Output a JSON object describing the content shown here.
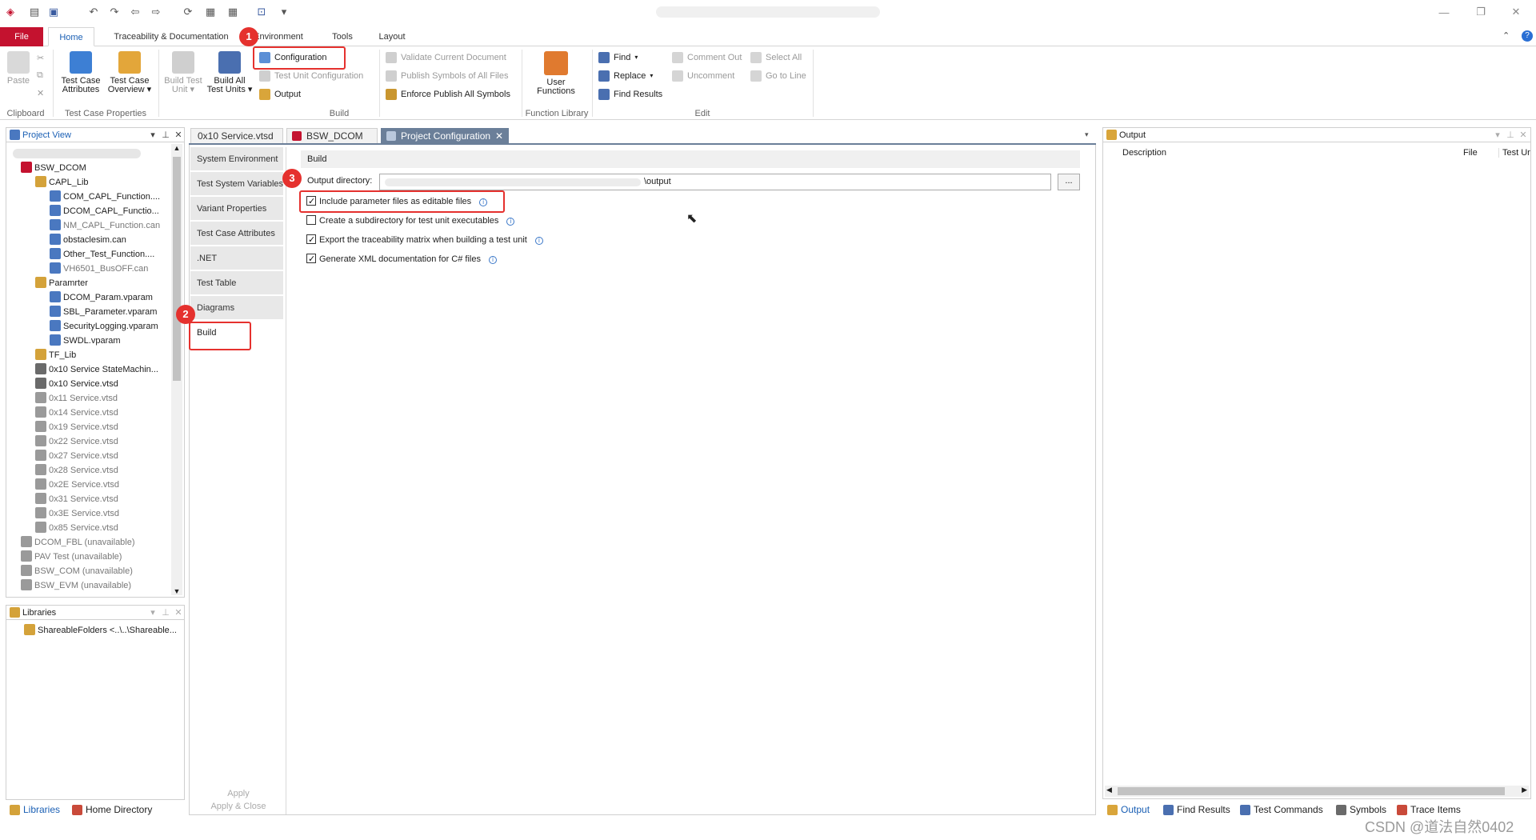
{
  "ribbon_tabs": [
    "File",
    "Home",
    "Traceability & Documentation",
    "Environment",
    "Tools",
    "Layout"
  ],
  "ribbon": {
    "clipboard": {
      "paste": "Paste",
      "group": "Clipboard"
    },
    "test_case_properties": {
      "attributes_line1": "Test Case",
      "attributes_line2": "Attributes",
      "overview_line1": "Test Case",
      "overview_line2": "Overview",
      "group": "Test Case Properties"
    },
    "build": {
      "build_test_unit_line1": "Build Test",
      "build_test_unit_line2": "Unit",
      "build_all_line1": "Build All",
      "build_all_line2": "Test Units",
      "configuration": "Configuration",
      "test_unit_configuration": "Test Unit Configuration",
      "output": "Output",
      "validate": "Validate Current Document",
      "publish": "Publish Symbols of All Files",
      "enforce": "Enforce Publish All Symbols",
      "group": "Build"
    },
    "function_library": {
      "user_line1": "User",
      "user_line2": "Functions",
      "group": "Function Library"
    },
    "edit": {
      "find": "Find",
      "replace": "Replace",
      "find_results": "Find Results",
      "comment_out": "Comment Out",
      "uncomment": "Uncomment",
      "select_all": "Select All",
      "go_to_line": "Go to Line",
      "group": "Edit"
    }
  },
  "markers": [
    "1",
    "2",
    "3"
  ],
  "project_view": {
    "title": "Project View",
    "items": [
      "BSW_DCOM",
      "CAPL_Lib",
      "COM_CAPL_Function....",
      "DCOM_CAPL_Functio...",
      "NM_CAPL_Function.can",
      "obstaclesim.can",
      "Other_Test_Function....",
      "VH6501_BusOFF.can",
      "Paramrter",
      "DCOM_Param.vparam",
      "SBL_Parameter.vparam",
      "SecurityLogging.vparam",
      "SWDL.vparam",
      "TF_Lib",
      "0x10 Service StateMachin...",
      "0x10 Service.vtsd",
      "0x11 Service.vtsd",
      "0x14 Service.vtsd",
      "0x19 Service.vtsd",
      "0x22 Service.vtsd",
      "0x27 Service.vtsd",
      "0x28 Service.vtsd",
      "0x2E Service.vtsd",
      "0x31 Service.vtsd",
      "0x3E Service.vtsd",
      "0x85 Service.vtsd",
      "DCOM_FBL (unavailable)",
      "PAV Test (unavailable)",
      "BSW_COM (unavailable)",
      "BSW_EVM (unavailable)"
    ]
  },
  "libraries": {
    "title": "Libraries",
    "item": "ShareableFolders <..\\..\\Shareable..."
  },
  "left_bottom_tabs": [
    "Libraries",
    "Home Directory"
  ],
  "doc_tabs": [
    "0x10 Service.vtsd",
    "BSW_DCOM",
    "Project Configuration"
  ],
  "config_nav": [
    "System Environment",
    "Test System Variables",
    "Variant Properties",
    "Test Case Attributes",
    ".NET",
    "Test Table",
    "Diagrams",
    "Build"
  ],
  "config_buttons": {
    "apply": "Apply",
    "apply_close": "Apply & Close"
  },
  "build_section": {
    "title": "Build",
    "output_label": "Output directory:",
    "output_value": "\\output",
    "browse": "...",
    "options": [
      {
        "label": "Include parameter files as editable files",
        "checked": true
      },
      {
        "label": "Create a subdirectory for test unit executables",
        "checked": false
      },
      {
        "label": "Export the traceability matrix when building a test unit",
        "checked": true
      },
      {
        "label": "Generate XML documentation for C# files",
        "checked": true
      }
    ]
  },
  "output_panel": {
    "title": "Output",
    "columns": [
      "Description",
      "File",
      "Test Ur"
    ]
  },
  "right_bottom_tabs": [
    "Output",
    "Find Results",
    "Test Commands",
    "Symbols",
    "Trace Items"
  ],
  "watermark": "CSDN @道法自然0402"
}
